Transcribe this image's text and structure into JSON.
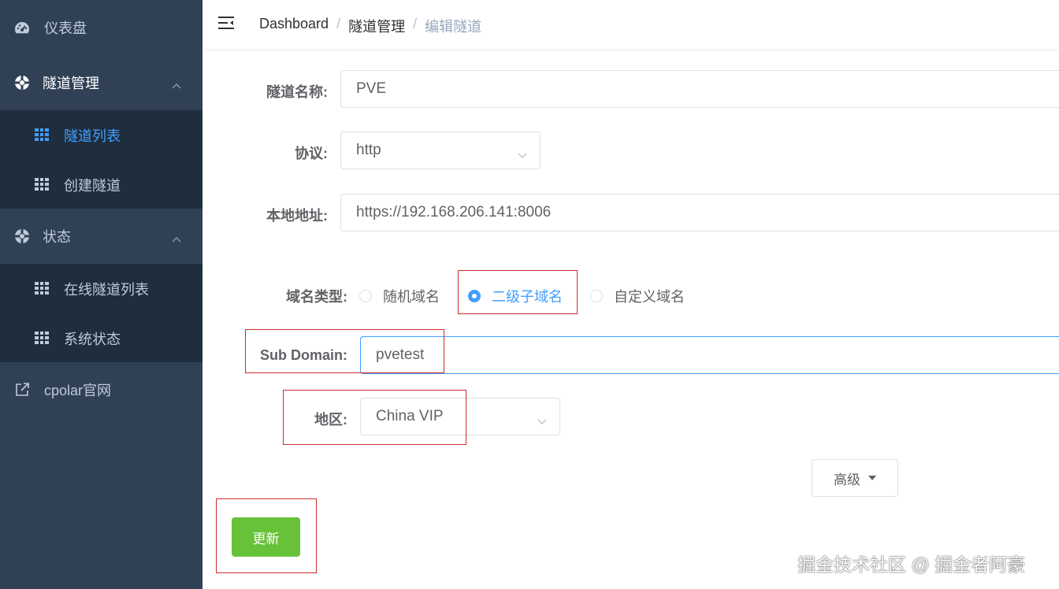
{
  "sidebar": {
    "items": [
      {
        "label": "仪表盘",
        "icon": "dashboard-icon"
      },
      {
        "label": "隧道管理",
        "icon": "lifebuoy-icon",
        "children": [
          {
            "label": "隧道列表",
            "icon": "grid-icon",
            "active": true
          },
          {
            "label": "创建隧道",
            "icon": "grid-icon"
          }
        ]
      },
      {
        "label": "状态",
        "icon": "lifebuoy-icon",
        "children": [
          {
            "label": "在线隧道列表",
            "icon": "grid-icon"
          },
          {
            "label": "系统状态",
            "icon": "grid-icon"
          }
        ]
      },
      {
        "label": "cpolar官网",
        "icon": "external-link-icon"
      }
    ]
  },
  "header": {
    "breadcrumb": [
      "Dashboard",
      "隧道管理",
      "编辑隧道"
    ],
    "separator": "/"
  },
  "form": {
    "tunnel_name": {
      "label": "隧道名称:",
      "value": "PVE"
    },
    "protocol": {
      "label": "协议:",
      "value": "http"
    },
    "local_address": {
      "label": "本地地址:",
      "value": "https://192.168.206.141:8006"
    },
    "domain_type": {
      "label": "域名类型:",
      "options": [
        "随机域名",
        "二级子域名",
        "自定义域名"
      ],
      "selected": "二级子域名"
    },
    "sub_domain": {
      "label": "Sub Domain:",
      "value": "pvetest"
    },
    "region": {
      "label": "地区:",
      "value": "China VIP"
    },
    "advanced_label": "高级",
    "update_label": "更新"
  },
  "watermark": "掘金技术社区 @ 掘金者阿豪",
  "colors": {
    "sidebar_bg": "#304156",
    "submenu_bg": "#1f2d3d",
    "accent": "#409eff",
    "success": "#67c23a",
    "highlight_box": "#cc2b2b"
  }
}
